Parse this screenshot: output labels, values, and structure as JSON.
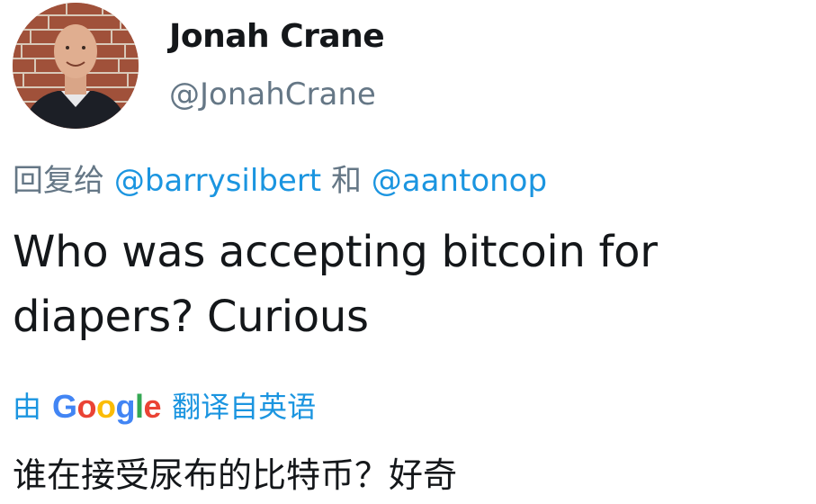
{
  "author": {
    "display_name": "Jonah Crane",
    "handle": "@JonahCrane"
  },
  "reply_context": {
    "prefix": "回复给",
    "mention_1": "@barrysilbert",
    "conjunction": "和",
    "mention_2": "@aantonop"
  },
  "tweet": {
    "text": "Who was accepting bitcoin for diapers? Curious"
  },
  "translation": {
    "by_label": "由",
    "service_logo": [
      "G",
      "o",
      "o",
      "g",
      "l",
      "e"
    ],
    "from_label": "翻译自英语",
    "translated_text": "谁在接受尿布的比特币？好奇"
  },
  "colors": {
    "link": "#1b95e0",
    "secondary_text": "#657786",
    "primary_text": "#14171a"
  }
}
